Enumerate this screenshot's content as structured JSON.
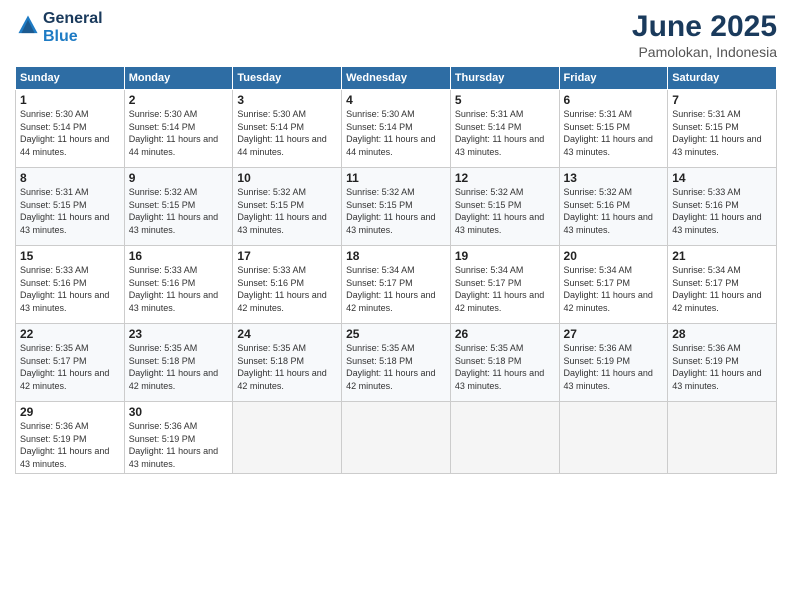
{
  "logo": {
    "line1": "General",
    "line2": "Blue"
  },
  "title": "June 2025",
  "location": "Pamolokan, Indonesia",
  "days_of_week": [
    "Sunday",
    "Monday",
    "Tuesday",
    "Wednesday",
    "Thursday",
    "Friday",
    "Saturday"
  ],
  "weeks": [
    [
      {
        "day": "1",
        "sunrise": "5:30 AM",
        "sunset": "5:14 PM",
        "daylight": "11 hours and 44 minutes."
      },
      {
        "day": "2",
        "sunrise": "5:30 AM",
        "sunset": "5:14 PM",
        "daylight": "11 hours and 44 minutes."
      },
      {
        "day": "3",
        "sunrise": "5:30 AM",
        "sunset": "5:14 PM",
        "daylight": "11 hours and 44 minutes."
      },
      {
        "day": "4",
        "sunrise": "5:30 AM",
        "sunset": "5:14 PM",
        "daylight": "11 hours and 44 minutes."
      },
      {
        "day": "5",
        "sunrise": "5:31 AM",
        "sunset": "5:14 PM",
        "daylight": "11 hours and 43 minutes."
      },
      {
        "day": "6",
        "sunrise": "5:31 AM",
        "sunset": "5:15 PM",
        "daylight": "11 hours and 43 minutes."
      },
      {
        "day": "7",
        "sunrise": "5:31 AM",
        "sunset": "5:15 PM",
        "daylight": "11 hours and 43 minutes."
      }
    ],
    [
      {
        "day": "8",
        "sunrise": "5:31 AM",
        "sunset": "5:15 PM",
        "daylight": "11 hours and 43 minutes."
      },
      {
        "day": "9",
        "sunrise": "5:32 AM",
        "sunset": "5:15 PM",
        "daylight": "11 hours and 43 minutes."
      },
      {
        "day": "10",
        "sunrise": "5:32 AM",
        "sunset": "5:15 PM",
        "daylight": "11 hours and 43 minutes."
      },
      {
        "day": "11",
        "sunrise": "5:32 AM",
        "sunset": "5:15 PM",
        "daylight": "11 hours and 43 minutes."
      },
      {
        "day": "12",
        "sunrise": "5:32 AM",
        "sunset": "5:15 PM",
        "daylight": "11 hours and 43 minutes."
      },
      {
        "day": "13",
        "sunrise": "5:32 AM",
        "sunset": "5:16 PM",
        "daylight": "11 hours and 43 minutes."
      },
      {
        "day": "14",
        "sunrise": "5:33 AM",
        "sunset": "5:16 PM",
        "daylight": "11 hours and 43 minutes."
      }
    ],
    [
      {
        "day": "15",
        "sunrise": "5:33 AM",
        "sunset": "5:16 PM",
        "daylight": "11 hours and 43 minutes."
      },
      {
        "day": "16",
        "sunrise": "5:33 AM",
        "sunset": "5:16 PM",
        "daylight": "11 hours and 43 minutes."
      },
      {
        "day": "17",
        "sunrise": "5:33 AM",
        "sunset": "5:16 PM",
        "daylight": "11 hours and 42 minutes."
      },
      {
        "day": "18",
        "sunrise": "5:34 AM",
        "sunset": "5:17 PM",
        "daylight": "11 hours and 42 minutes."
      },
      {
        "day": "19",
        "sunrise": "5:34 AM",
        "sunset": "5:17 PM",
        "daylight": "11 hours and 42 minutes."
      },
      {
        "day": "20",
        "sunrise": "5:34 AM",
        "sunset": "5:17 PM",
        "daylight": "11 hours and 42 minutes."
      },
      {
        "day": "21",
        "sunrise": "5:34 AM",
        "sunset": "5:17 PM",
        "daylight": "11 hours and 42 minutes."
      }
    ],
    [
      {
        "day": "22",
        "sunrise": "5:35 AM",
        "sunset": "5:17 PM",
        "daylight": "11 hours and 42 minutes."
      },
      {
        "day": "23",
        "sunrise": "5:35 AM",
        "sunset": "5:18 PM",
        "daylight": "11 hours and 42 minutes."
      },
      {
        "day": "24",
        "sunrise": "5:35 AM",
        "sunset": "5:18 PM",
        "daylight": "11 hours and 42 minutes."
      },
      {
        "day": "25",
        "sunrise": "5:35 AM",
        "sunset": "5:18 PM",
        "daylight": "11 hours and 42 minutes."
      },
      {
        "day": "26",
        "sunrise": "5:35 AM",
        "sunset": "5:18 PM",
        "daylight": "11 hours and 43 minutes."
      },
      {
        "day": "27",
        "sunrise": "5:36 AM",
        "sunset": "5:19 PM",
        "daylight": "11 hours and 43 minutes."
      },
      {
        "day": "28",
        "sunrise": "5:36 AM",
        "sunset": "5:19 PM",
        "daylight": "11 hours and 43 minutes."
      }
    ],
    [
      {
        "day": "29",
        "sunrise": "5:36 AM",
        "sunset": "5:19 PM",
        "daylight": "11 hours and 43 minutes."
      },
      {
        "day": "30",
        "sunrise": "5:36 AM",
        "sunset": "5:19 PM",
        "daylight": "11 hours and 43 minutes."
      },
      null,
      null,
      null,
      null,
      null
    ]
  ],
  "labels": {
    "sunrise": "Sunrise:",
    "sunset": "Sunset:",
    "daylight": "Daylight:"
  }
}
